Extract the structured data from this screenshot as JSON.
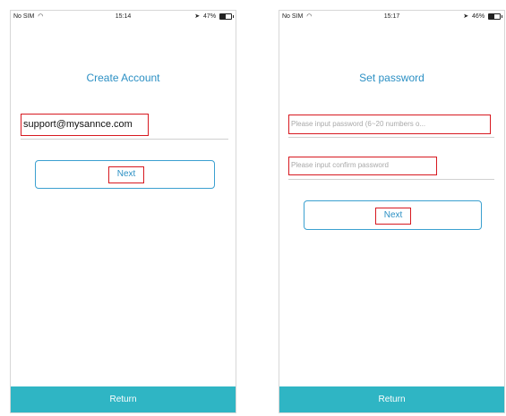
{
  "left_screen": {
    "status": {
      "carrier": "No SIM",
      "time": "15:14",
      "battery": "47%",
      "battery_level": 0.47
    },
    "title": "Create Account",
    "email_value": "support@mysannce.com",
    "next_label": "Next",
    "return_label": "Return"
  },
  "right_screen": {
    "status": {
      "carrier": "No SIM",
      "time": "15:17",
      "battery": "46%",
      "battery_level": 0.46
    },
    "title": "Set password",
    "password_placeholder": "Please input password (6~20 numbers o...",
    "confirm_placeholder": "Please input confirm password",
    "next_label": "Next",
    "return_label": "Return"
  },
  "colors": {
    "accent": "#2c90c4",
    "button_border": "#3ba0d0",
    "highlight": "#d71920",
    "return_bar": "#2fb5c4"
  },
  "icons": [
    "wifi-icon",
    "location-arrow-icon",
    "battery-icon"
  ]
}
